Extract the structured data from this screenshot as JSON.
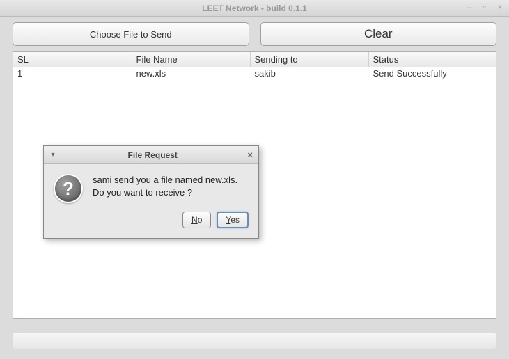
{
  "window": {
    "title": "LEET Network - build 0.1.1"
  },
  "buttons": {
    "choose": "Choose File to Send",
    "clear": "Clear"
  },
  "table": {
    "headers": {
      "sl": "SL",
      "filename": "File Name",
      "sendingto": "Sending to",
      "status": "Status"
    },
    "rows": [
      {
        "sl": "1",
        "filename": "new.xls",
        "sendingto": "sakib",
        "status": "Send Successfully"
      }
    ]
  },
  "dialog": {
    "title": "File Request",
    "message_line1": "sami send you a file named new.xls.",
    "message_line2": "Do you want to receive ?",
    "no": "No",
    "yes": "Yes"
  }
}
